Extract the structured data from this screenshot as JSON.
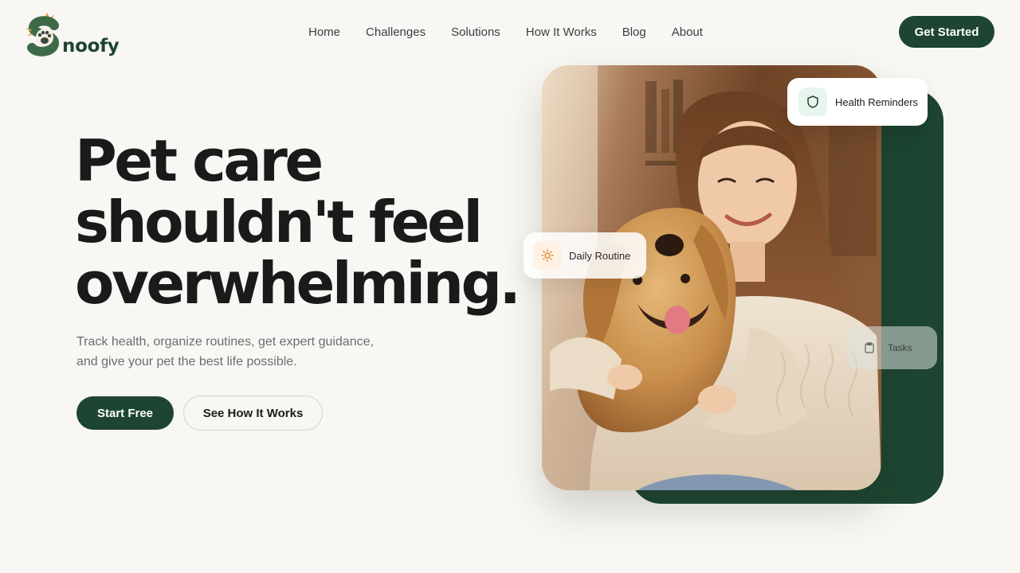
{
  "brand": {
    "name": "noofy",
    "color": "#1d4531"
  },
  "nav": {
    "items": [
      "Home",
      "Challenges",
      "Solutions",
      "How It Works",
      "Blog",
      "About"
    ],
    "cta_label": "Get Started"
  },
  "hero": {
    "headline_lines": [
      "Pet care",
      "shouldn't feel",
      "overwhelming."
    ],
    "subtitle_lines": [
      "Track health, organize routines, get expert guidance,",
      "and give your pet the best life possible."
    ],
    "primary_button": "Start Free",
    "secondary_button": "See How It Works"
  },
  "visual": {
    "photo_alt": "Woman hugging a golden retriever",
    "cards": {
      "health": {
        "label": "Health Reminders",
        "icon": "shield-icon"
      },
      "routine": {
        "label": "Daily Routine",
        "icon": "sun-icon"
      },
      "tasks": {
        "label": "Tasks",
        "icon": "clipboard-icon"
      }
    }
  },
  "colors": {
    "background": "#f8f7f3",
    "accent_green": "#1d4531",
    "text_dark": "#1a1a1a",
    "text_muted": "#6a6e72"
  }
}
